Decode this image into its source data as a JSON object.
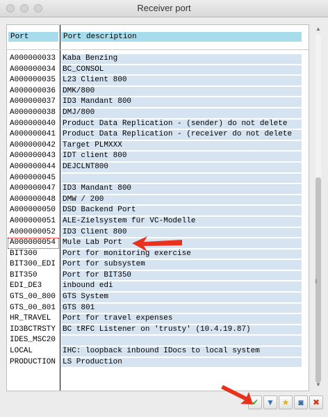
{
  "window": {
    "title": "Receiver port"
  },
  "columns": {
    "port": "Port",
    "description": "Port description"
  },
  "rows": [
    {
      "port": "A000000033",
      "desc": "Kaba Benzing"
    },
    {
      "port": "A000000034",
      "desc": "BC_CONSOL"
    },
    {
      "port": "A000000035",
      "desc": "L23 Client 800"
    },
    {
      "port": "A000000036",
      "desc": "DMK/800"
    },
    {
      "port": "A000000037",
      "desc": "ID3 Mandant 800"
    },
    {
      "port": "A000000038",
      "desc": "DMJ/800"
    },
    {
      "port": "A000000040",
      "desc": "Product Data Replication - (sender) do not delete"
    },
    {
      "port": "A000000041",
      "desc": "Product Data Replication - (receiver do not delete"
    },
    {
      "port": "A000000042",
      "desc": "Target PLMXXX"
    },
    {
      "port": "A000000043",
      "desc": "IDT client 800"
    },
    {
      "port": "A000000044",
      "desc": "DEJCLNT800"
    },
    {
      "port": "A000000045",
      "desc": ""
    },
    {
      "port": "A000000047",
      "desc": "ID3 Mandant 800"
    },
    {
      "port": "A000000048",
      "desc": "DMW / 200"
    },
    {
      "port": "A000000050",
      "desc": "DSD Backend Port"
    },
    {
      "port": "A000000051",
      "desc": "ALE-Zielsystem für VC-Modelle"
    },
    {
      "port": "A000000052",
      "desc": "ID3 Client 800"
    },
    {
      "port": "A000000054",
      "desc": "Mule Lab Port"
    },
    {
      "port": "BIT300",
      "desc": "Port for monitoring exercise"
    },
    {
      "port": "BIT300_EDI",
      "desc": "Port for subsystem"
    },
    {
      "port": "BIT350",
      "desc": "Port for BIT350"
    },
    {
      "port": "EDI_DE3",
      "desc": "inbound edi"
    },
    {
      "port": "GTS_00_800",
      "desc": "GTS System"
    },
    {
      "port": "GTS_00_801",
      "desc": "GTS 801"
    },
    {
      "port": "HR_TRAVEL",
      "desc": "Port for travel expenses"
    },
    {
      "port": "ID3BCTRSTY",
      "desc": "BC tRFC Listener on 'trusty' (10.4.19.87)"
    },
    {
      "port": "IDES_MSC20",
      "desc": ""
    },
    {
      "port": "LOCAL",
      "desc": "IHC: loopback inbound IDocs to local system"
    },
    {
      "port": "PRODUCTION",
      "desc": "LS Production"
    }
  ],
  "selected_index": 17,
  "colors": {
    "header_bg": "#a7dcec",
    "desc_bg": "#d6e4f2",
    "annotation": "#e8321e"
  },
  "toolbar": {
    "buttons": [
      {
        "name": "confirm-button",
        "icon": "checkmark-icon",
        "glyph": "✔",
        "color": "#3aa53a"
      },
      {
        "name": "filter-button",
        "icon": "filter-icon",
        "glyph": "▼",
        "color": "#3a6fb0"
      },
      {
        "name": "add-favorite-button",
        "icon": "star-plus-icon",
        "glyph": "★",
        "color": "#e0b020"
      },
      {
        "name": "find-button",
        "icon": "binoculars-icon",
        "glyph": "◙",
        "color": "#2d5d9a"
      },
      {
        "name": "cancel-button",
        "icon": "close-icon",
        "glyph": "✖",
        "color": "#d03a1a"
      }
    ]
  }
}
